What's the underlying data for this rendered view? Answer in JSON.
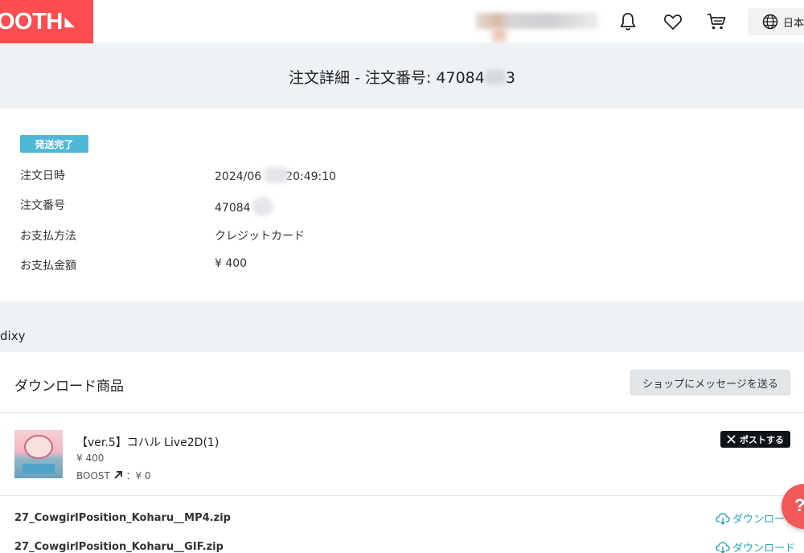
{
  "header": {
    "logo_text": "OOTH",
    "lang_label": "日本"
  },
  "title": "注文詳細 - 注文番号: 47084",
  "title_suffix": "3",
  "order": {
    "status_badge": "発送完了",
    "rows": [
      {
        "label": "注文日時",
        "value": "2024/06",
        "value_suffix": "20:49:10"
      },
      {
        "label": "注文番号",
        "value": "47084",
        "value_suffix": ""
      },
      {
        "label": "お支払方法",
        "value": "クレジットカード",
        "value_suffix": ""
      },
      {
        "label": "お支払金額",
        "value": "¥ 400",
        "value_suffix": ""
      }
    ]
  },
  "shop": {
    "name": "dixy"
  },
  "download": {
    "title": "ダウンロード商品",
    "message_button": "ショップにメッセージを送る",
    "item": {
      "name": "【ver.5】コハル Live2D(1)",
      "price": "¥ 400",
      "boost": "BOOST",
      "boost_value": "：¥ 0",
      "post_button": "ポストする"
    },
    "files": [
      {
        "name": "27_CowgirlPosition_Koharu__MP4.zip",
        "link": "ダウンロード"
      },
      {
        "name": "27_CowgirlPosition_Koharu__GIF.zip",
        "link": "ダウンロード"
      }
    ]
  },
  "help_label": "?"
}
